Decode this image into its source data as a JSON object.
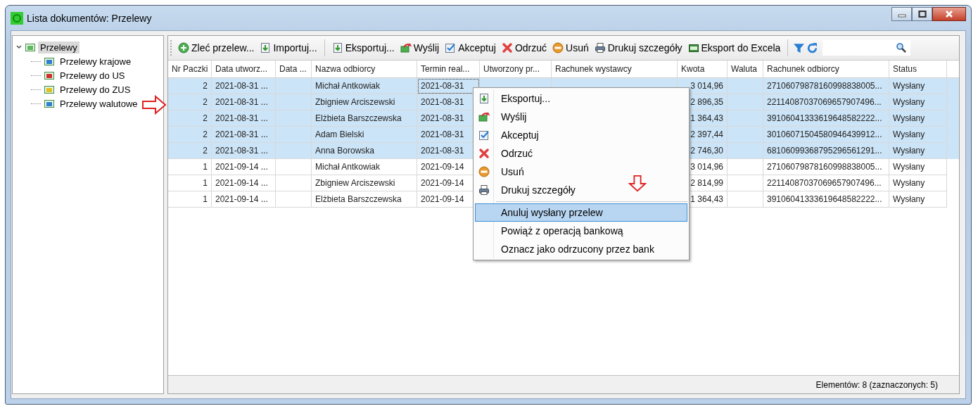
{
  "window": {
    "title": "Lista dokumentów: Przelewy"
  },
  "tree": [
    {
      "label": "Przelewy",
      "expanded": true,
      "selected": true,
      "color": "#5cb85c",
      "children": [
        {
          "label": "Przelewy krajowe",
          "selected": false,
          "color": "#2f7fd0"
        },
        {
          "label": "Przelewy do US",
          "selected": false,
          "color": "#d03030"
        },
        {
          "label": "Przelewy do ZUS",
          "selected": false,
          "color": "#e0c020"
        },
        {
          "label": "Przelewy walutowe",
          "selected": false,
          "color": "#2f7fd0"
        }
      ]
    }
  ],
  "toolbar": [
    {
      "kind": "add",
      "label": "Zleć przelew..."
    },
    {
      "kind": "import",
      "label": "Importuj..."
    },
    {
      "kind": "separator"
    },
    {
      "kind": "export",
      "label": "Eksportuj..."
    },
    {
      "kind": "send",
      "label": "Wyślij"
    },
    {
      "kind": "accept",
      "label": "Akceptuj"
    },
    {
      "kind": "reject",
      "label": "Odrzuć"
    },
    {
      "kind": "delete",
      "label": "Usuń"
    },
    {
      "kind": "print",
      "label": "Drukuj szczegóły"
    },
    {
      "kind": "excel",
      "label": "Eksport do Excela"
    }
  ],
  "table": {
    "columns": [
      {
        "label": "Nr Paczki",
        "kind": "number"
      },
      {
        "label": "Data utworz...",
        "kind": "text"
      },
      {
        "label": "Data ...",
        "kind": "text"
      },
      {
        "label": "Nazwa odbiorcy",
        "kind": "text"
      },
      {
        "label": "Termin real...",
        "kind": "text"
      },
      {
        "label": "Utworzony pr...",
        "kind": "text"
      },
      {
        "label": "Rachunek wystawcy",
        "kind": "text"
      },
      {
        "label": "Kwota",
        "kind": "number"
      },
      {
        "label": "Waluta",
        "kind": "text"
      },
      {
        "label": "Rachunek odbiorcy",
        "kind": "text"
      },
      {
        "label": "Status",
        "kind": "text"
      }
    ],
    "rows": [
      {
        "selected": true,
        "cells": [
          "2",
          "2021-08-31 ...",
          null,
          "Michał Antkowiak",
          "2021-08-31",
          null,
          null,
          "3 014,96",
          null,
          "27106079878160998838005...",
          "Wysłany"
        ]
      },
      {
        "selected": true,
        "cells": [
          "2",
          "2021-08-31 ...",
          null,
          "Zbigniew Arciszewski",
          "2021-08-31",
          null,
          null,
          "2 896,35",
          null,
          "22114087037069657907496...",
          "Wysłany"
        ]
      },
      {
        "selected": true,
        "cells": [
          "2",
          "2021-08-31 ...",
          null,
          "Elżbieta Barszczewska",
          "2021-08-31",
          null,
          null,
          "1 364,43",
          null,
          "39106041333619648582222...",
          "Wysłany"
        ]
      },
      {
        "selected": true,
        "cells": [
          "2",
          "2021-08-31 ...",
          null,
          "Adam Bielski",
          "2021-08-31",
          null,
          null,
          "2 397,44",
          null,
          "30106071504580946439912...",
          "Wysłany"
        ]
      },
      {
        "selected": true,
        "cells": [
          "2",
          "2021-08-31 ...",
          null,
          "Anna Borowska",
          "2021-08-31",
          null,
          null,
          "2 746,30",
          null,
          "68106099368795296561291...",
          "Wysłany"
        ]
      },
      {
        "selected": false,
        "cells": [
          "1",
          "2021-09-14 ...",
          null,
          "Michał Antkowiak",
          "2021-09-14",
          null,
          null,
          "3 014,96",
          null,
          "27106079878160998838005...",
          "Wysłany"
        ]
      },
      {
        "selected": false,
        "cells": [
          "1",
          "2021-09-14 ...",
          null,
          "Zbigniew Arciszewski",
          "2021-09-14",
          null,
          null,
          "2 814,99",
          null,
          "22114087037069657907496...",
          "Wysłany"
        ]
      },
      {
        "selected": false,
        "cells": [
          "1",
          "2021-09-14 ...",
          null,
          "Elżbieta Barszczewska",
          "2021-09-14",
          null,
          null,
          "1 364,43",
          null,
          "39106041333619648582222...",
          "Wysłany"
        ]
      }
    ]
  },
  "context_menu": [
    {
      "kind": "export",
      "label": "Eksportuj...",
      "selected": false
    },
    {
      "kind": "send",
      "label": "Wyślij",
      "selected": false
    },
    {
      "kind": "accept",
      "label": "Akceptuj",
      "selected": false
    },
    {
      "kind": "reject",
      "label": "Odrzuć",
      "selected": false
    },
    {
      "kind": "delete",
      "label": "Usuń",
      "selected": false
    },
    {
      "kind": "print",
      "label": "Drukuj szczegóły",
      "selected": false
    },
    {
      "kind": "separator"
    },
    {
      "kind": "none",
      "label": "Anuluj wysłany przelew",
      "selected": true
    },
    {
      "kind": "none",
      "label": "Powiąż z operacją bankową",
      "selected": false
    },
    {
      "kind": "none",
      "label": "Oznacz jako odrzucony przez bank",
      "selected": false
    }
  ],
  "status_bar": {
    "text": "Elementów: 8 (zaznaczonych: 5)"
  }
}
